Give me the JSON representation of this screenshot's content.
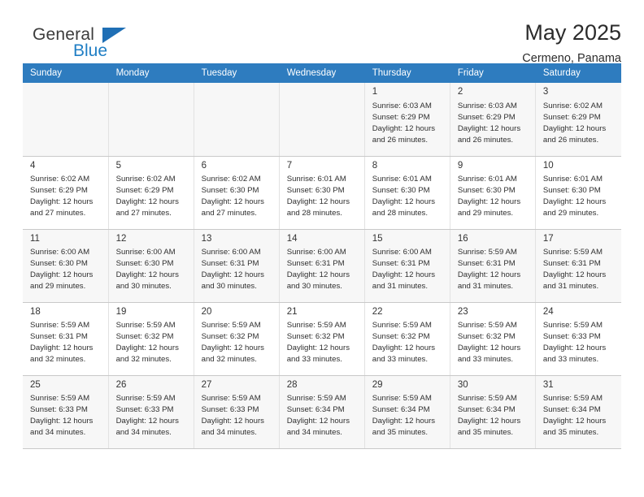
{
  "brand": {
    "name_top": "General",
    "name_bottom": "Blue",
    "accent_color": "#1f7ec4",
    "triangle_color": "#1f6fb5"
  },
  "header": {
    "title": "May 2025",
    "subtitle": "Cermeno, Panama"
  },
  "calendar": {
    "header_bg": "#2e7cbf",
    "weekdays": [
      "Sunday",
      "Monday",
      "Tuesday",
      "Wednesday",
      "Thursday",
      "Friday",
      "Saturday"
    ],
    "labels": {
      "sunrise": "Sunrise:",
      "sunset": "Sunset:",
      "daylight": "Daylight:"
    },
    "weeks": [
      [
        {
          "day": "",
          "sunrise": "",
          "sunset": "",
          "daylight_line1": "",
          "daylight_line2": "",
          "empty": true
        },
        {
          "day": "",
          "sunrise": "",
          "sunset": "",
          "daylight_line1": "",
          "daylight_line2": "",
          "empty": true
        },
        {
          "day": "",
          "sunrise": "",
          "sunset": "",
          "daylight_line1": "",
          "daylight_line2": "",
          "empty": true
        },
        {
          "day": "",
          "sunrise": "",
          "sunset": "",
          "daylight_line1": "",
          "daylight_line2": "",
          "empty": true
        },
        {
          "day": "1",
          "sunrise": "Sunrise: 6:03 AM",
          "sunset": "Sunset: 6:29 PM",
          "daylight_line1": "Daylight: 12 hours",
          "daylight_line2": "and 26 minutes."
        },
        {
          "day": "2",
          "sunrise": "Sunrise: 6:03 AM",
          "sunset": "Sunset: 6:29 PM",
          "daylight_line1": "Daylight: 12 hours",
          "daylight_line2": "and 26 minutes."
        },
        {
          "day": "3",
          "sunrise": "Sunrise: 6:02 AM",
          "sunset": "Sunset: 6:29 PM",
          "daylight_line1": "Daylight: 12 hours",
          "daylight_line2": "and 26 minutes."
        }
      ],
      [
        {
          "day": "4",
          "sunrise": "Sunrise: 6:02 AM",
          "sunset": "Sunset: 6:29 PM",
          "daylight_line1": "Daylight: 12 hours",
          "daylight_line2": "and 27 minutes."
        },
        {
          "day": "5",
          "sunrise": "Sunrise: 6:02 AM",
          "sunset": "Sunset: 6:29 PM",
          "daylight_line1": "Daylight: 12 hours",
          "daylight_line2": "and 27 minutes."
        },
        {
          "day": "6",
          "sunrise": "Sunrise: 6:02 AM",
          "sunset": "Sunset: 6:30 PM",
          "daylight_line1": "Daylight: 12 hours",
          "daylight_line2": "and 27 minutes."
        },
        {
          "day": "7",
          "sunrise": "Sunrise: 6:01 AM",
          "sunset": "Sunset: 6:30 PM",
          "daylight_line1": "Daylight: 12 hours",
          "daylight_line2": "and 28 minutes."
        },
        {
          "day": "8",
          "sunrise": "Sunrise: 6:01 AM",
          "sunset": "Sunset: 6:30 PM",
          "daylight_line1": "Daylight: 12 hours",
          "daylight_line2": "and 28 minutes."
        },
        {
          "day": "9",
          "sunrise": "Sunrise: 6:01 AM",
          "sunset": "Sunset: 6:30 PM",
          "daylight_line1": "Daylight: 12 hours",
          "daylight_line2": "and 29 minutes."
        },
        {
          "day": "10",
          "sunrise": "Sunrise: 6:01 AM",
          "sunset": "Sunset: 6:30 PM",
          "daylight_line1": "Daylight: 12 hours",
          "daylight_line2": "and 29 minutes."
        }
      ],
      [
        {
          "day": "11",
          "sunrise": "Sunrise: 6:00 AM",
          "sunset": "Sunset: 6:30 PM",
          "daylight_line1": "Daylight: 12 hours",
          "daylight_line2": "and 29 minutes."
        },
        {
          "day": "12",
          "sunrise": "Sunrise: 6:00 AM",
          "sunset": "Sunset: 6:30 PM",
          "daylight_line1": "Daylight: 12 hours",
          "daylight_line2": "and 30 minutes."
        },
        {
          "day": "13",
          "sunrise": "Sunrise: 6:00 AM",
          "sunset": "Sunset: 6:31 PM",
          "daylight_line1": "Daylight: 12 hours",
          "daylight_line2": "and 30 minutes."
        },
        {
          "day": "14",
          "sunrise": "Sunrise: 6:00 AM",
          "sunset": "Sunset: 6:31 PM",
          "daylight_line1": "Daylight: 12 hours",
          "daylight_line2": "and 30 minutes."
        },
        {
          "day": "15",
          "sunrise": "Sunrise: 6:00 AM",
          "sunset": "Sunset: 6:31 PM",
          "daylight_line1": "Daylight: 12 hours",
          "daylight_line2": "and 31 minutes."
        },
        {
          "day": "16",
          "sunrise": "Sunrise: 5:59 AM",
          "sunset": "Sunset: 6:31 PM",
          "daylight_line1": "Daylight: 12 hours",
          "daylight_line2": "and 31 minutes."
        },
        {
          "day": "17",
          "sunrise": "Sunrise: 5:59 AM",
          "sunset": "Sunset: 6:31 PM",
          "daylight_line1": "Daylight: 12 hours",
          "daylight_line2": "and 31 minutes."
        }
      ],
      [
        {
          "day": "18",
          "sunrise": "Sunrise: 5:59 AM",
          "sunset": "Sunset: 6:31 PM",
          "daylight_line1": "Daylight: 12 hours",
          "daylight_line2": "and 32 minutes."
        },
        {
          "day": "19",
          "sunrise": "Sunrise: 5:59 AM",
          "sunset": "Sunset: 6:32 PM",
          "daylight_line1": "Daylight: 12 hours",
          "daylight_line2": "and 32 minutes."
        },
        {
          "day": "20",
          "sunrise": "Sunrise: 5:59 AM",
          "sunset": "Sunset: 6:32 PM",
          "daylight_line1": "Daylight: 12 hours",
          "daylight_line2": "and 32 minutes."
        },
        {
          "day": "21",
          "sunrise": "Sunrise: 5:59 AM",
          "sunset": "Sunset: 6:32 PM",
          "daylight_line1": "Daylight: 12 hours",
          "daylight_line2": "and 33 minutes."
        },
        {
          "day": "22",
          "sunrise": "Sunrise: 5:59 AM",
          "sunset": "Sunset: 6:32 PM",
          "daylight_line1": "Daylight: 12 hours",
          "daylight_line2": "and 33 minutes."
        },
        {
          "day": "23",
          "sunrise": "Sunrise: 5:59 AM",
          "sunset": "Sunset: 6:32 PM",
          "daylight_line1": "Daylight: 12 hours",
          "daylight_line2": "and 33 minutes."
        },
        {
          "day": "24",
          "sunrise": "Sunrise: 5:59 AM",
          "sunset": "Sunset: 6:33 PM",
          "daylight_line1": "Daylight: 12 hours",
          "daylight_line2": "and 33 minutes."
        }
      ],
      [
        {
          "day": "25",
          "sunrise": "Sunrise: 5:59 AM",
          "sunset": "Sunset: 6:33 PM",
          "daylight_line1": "Daylight: 12 hours",
          "daylight_line2": "and 34 minutes."
        },
        {
          "day": "26",
          "sunrise": "Sunrise: 5:59 AM",
          "sunset": "Sunset: 6:33 PM",
          "daylight_line1": "Daylight: 12 hours",
          "daylight_line2": "and 34 minutes."
        },
        {
          "day": "27",
          "sunrise": "Sunrise: 5:59 AM",
          "sunset": "Sunset: 6:33 PM",
          "daylight_line1": "Daylight: 12 hours",
          "daylight_line2": "and 34 minutes."
        },
        {
          "day": "28",
          "sunrise": "Sunrise: 5:59 AM",
          "sunset": "Sunset: 6:34 PM",
          "daylight_line1": "Daylight: 12 hours",
          "daylight_line2": "and 34 minutes."
        },
        {
          "day": "29",
          "sunrise": "Sunrise: 5:59 AM",
          "sunset": "Sunset: 6:34 PM",
          "daylight_line1": "Daylight: 12 hours",
          "daylight_line2": "and 35 minutes."
        },
        {
          "day": "30",
          "sunrise": "Sunrise: 5:59 AM",
          "sunset": "Sunset: 6:34 PM",
          "daylight_line1": "Daylight: 12 hours",
          "daylight_line2": "and 35 minutes."
        },
        {
          "day": "31",
          "sunrise": "Sunrise: 5:59 AM",
          "sunset": "Sunset: 6:34 PM",
          "daylight_line1": "Daylight: 12 hours",
          "daylight_line2": "and 35 minutes."
        }
      ]
    ]
  }
}
